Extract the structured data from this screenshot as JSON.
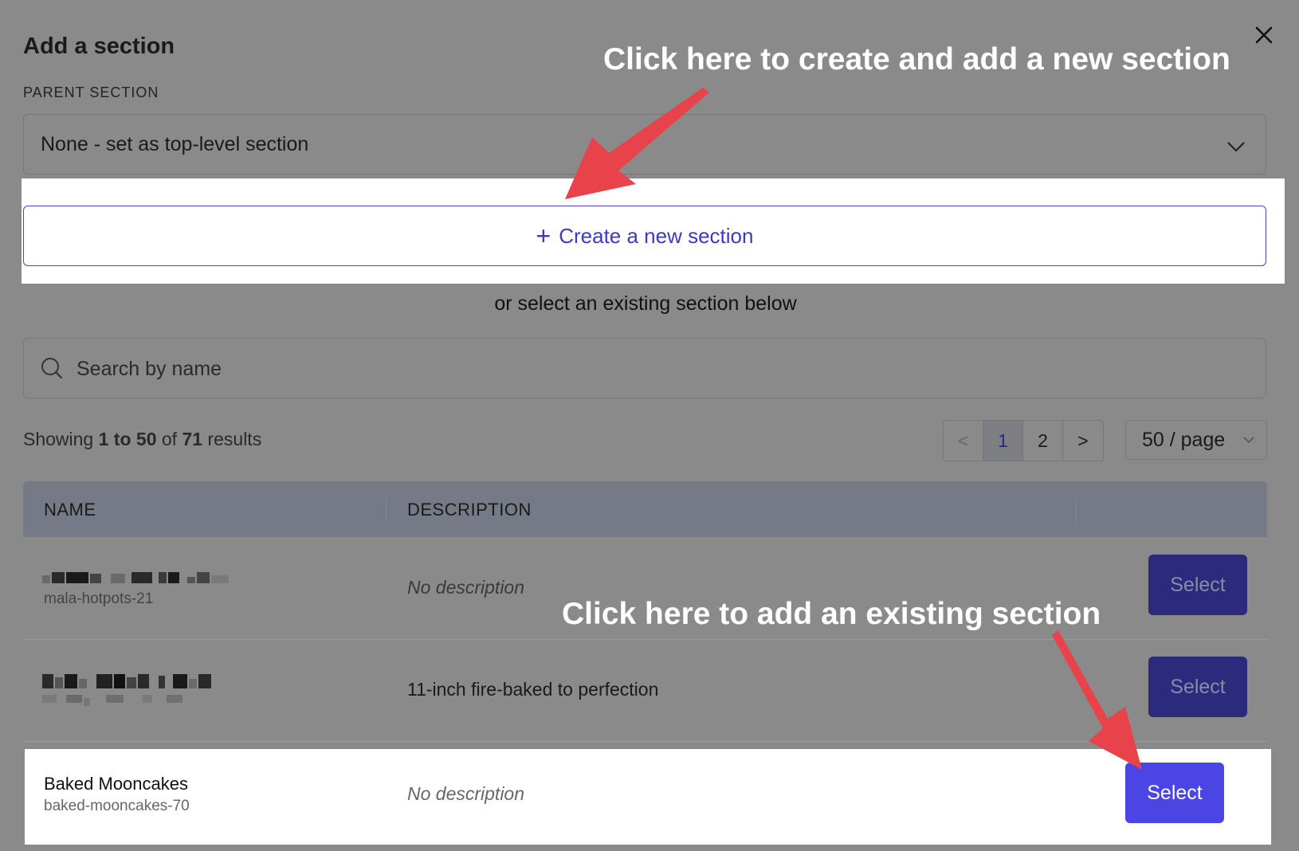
{
  "dialog": {
    "title": "Add a section",
    "parent_label": "PARENT SECTION",
    "parent_value": "None - set as top-level section",
    "create_label": "Create a new section",
    "or_text": "or select an existing section below",
    "search_placeholder": "Search by name"
  },
  "results": {
    "prefix": "Showing",
    "range": "1 to 50",
    "of": "of",
    "total": "71",
    "suffix": "results"
  },
  "pagination": {
    "prev": "<",
    "pages": [
      "1",
      "2"
    ],
    "current": "1",
    "next": ">",
    "per_page": "50 / page"
  },
  "table": {
    "headers": [
      "NAME",
      "DESCRIPTION"
    ],
    "rows": [
      {
        "name": "",
        "slug": "mala-hotpots-21",
        "description": "No description",
        "action": "Select"
      },
      {
        "name": "",
        "slug": "",
        "description": "11-inch fire-baked to perfection",
        "action": "Select"
      },
      {
        "name": "Baked Mooncakes",
        "slug": "baked-mooncakes-70",
        "description": "No description",
        "action": "Select"
      }
    ]
  },
  "annotations": {
    "create": "Click here to create and add a new section",
    "existing": "Click here to add an existing section"
  },
  "colors": {
    "accent": "#4b45e4",
    "annotation_arrow": "#e8434a",
    "overlay": "#8a8a8a"
  }
}
